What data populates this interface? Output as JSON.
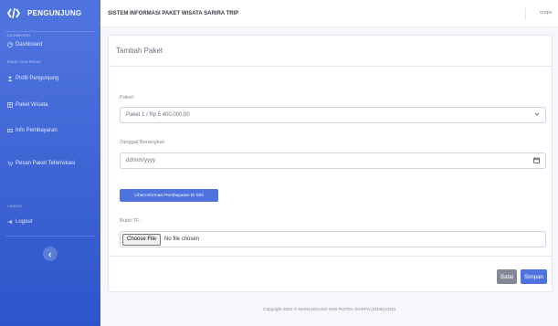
{
  "sidebar": {
    "brand": "PENGUNJUNG",
    "heading_dashboard": "DASHBOARD",
    "dashboard": "Dashboard",
    "heading_paket": "PAKET DAN PESAN",
    "profil": "Profil Pengunjung",
    "paket_wisata": "Paket Wisata",
    "info_pembayaran": "Info Pembayaran",
    "pesan_paket": "Pesan Paket Teferivikasi",
    "heading_logout": "LOGOUT",
    "logout": "Logout"
  },
  "topbar": {
    "title": "SISTEM INFORMASI PAKET WISATA SARIRA TRIP",
    "user": "mdps"
  },
  "form": {
    "header": "Tambah Paket",
    "paket_label": "Paket:",
    "paket_value": "Paket 1 / Rp 5.400.000,00",
    "tanggal_label": "Tanggal Berangkat:",
    "tanggal_placeholder": "dd/mm/yyyy",
    "info_button": "Lihat Informasi Pembayaran Di Sini",
    "bukti_label": "Bukti TF:",
    "choose_file": "Choose File",
    "no_file": "No file chosen",
    "batal": "Batal",
    "simpan": "Simpan"
  },
  "footer": "Copyright 2022 © MARCHELINO DWI PUTRA SIAPPA (216611015)",
  "colors": {
    "primary": "#4e73df",
    "secondary": "#858796"
  }
}
